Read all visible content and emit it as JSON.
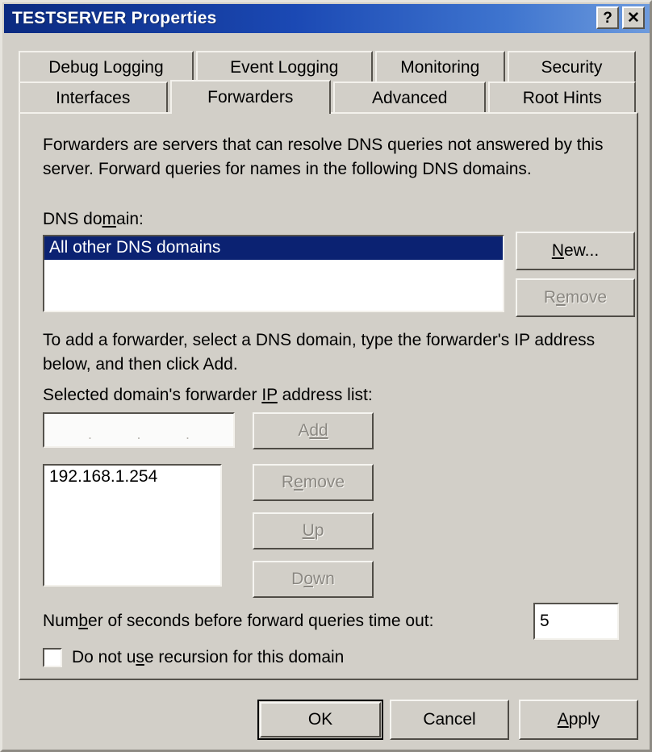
{
  "window": {
    "title": "TESTSERVER Properties",
    "help_button": "?",
    "close_button": "✕",
    "titlebar_color": "#0b2a80",
    "background_color": "#d2cfc8"
  },
  "tabs": {
    "row1": [
      {
        "label": "Debug Logging",
        "active": false
      },
      {
        "label": "Event Logging",
        "active": false
      },
      {
        "label": "Monitoring",
        "active": false
      },
      {
        "label": "Security",
        "active": false
      }
    ],
    "row2": [
      {
        "label": "Interfaces",
        "active": false
      },
      {
        "label": "Forwarders",
        "active": true
      },
      {
        "label": "Advanced",
        "active": false
      },
      {
        "label": "Root Hints",
        "active": false
      }
    ],
    "active_tab": "Forwarders"
  },
  "panel": {
    "description": "Forwarders are servers that can resolve DNS queries not answered by this\nserver. Forward queries for names in the following DNS domains.",
    "dns_domain_label_pre": "DNS do",
    "dns_domain_label_accel": "m",
    "dns_domain_label_post": "ain:",
    "domain_list": [
      {
        "text": "All other DNS domains",
        "selected": true
      }
    ],
    "new_button": {
      "pre": "",
      "accel": "N",
      "post": "ew...",
      "enabled": true
    },
    "remove_domain_button": {
      "pre": "R",
      "accel": "e",
      "post": "move",
      "enabled": false
    },
    "add_instructions": "To add a forwarder, select a DNS domain, type the forwarder's IP address\nbelow, and then click Add.",
    "ip_list_label_pre": "Selected domain's forwarder ",
    "ip_list_label_accel": "IP",
    "ip_list_label_post": " address list:",
    "ip_entry_value": "",
    "ip_entry_separator": ".",
    "add_button": {
      "pre": "A",
      "accel": "dd",
      "post": "",
      "enabled": false
    },
    "forwarder_ip_list": [
      {
        "text": "192.168.1.254",
        "selected": false
      }
    ],
    "remove_ip_button": {
      "pre": "R",
      "accel": "e",
      "post": "move",
      "enabled": false
    },
    "up_button": {
      "pre": "",
      "accel": "U",
      "post": "p",
      "enabled": false
    },
    "down_button": {
      "pre": "D",
      "accel": "o",
      "post": "wn",
      "enabled": false
    },
    "timeout_label_pre": "Num",
    "timeout_label_accel": "b",
    "timeout_label_post": "er of seconds before forward queries time out:",
    "timeout_value": "5",
    "recursion_checkbox": {
      "pre": "Do not u",
      "accel": "s",
      "post": "e recursion for this domain",
      "checked": false
    }
  },
  "footer": {
    "ok_button": {
      "label": "OK",
      "default": true
    },
    "cancel_button": {
      "label": "Cancel",
      "default": false
    },
    "apply_button": {
      "pre": "",
      "accel": "A",
      "post": "pply",
      "default": false
    }
  }
}
